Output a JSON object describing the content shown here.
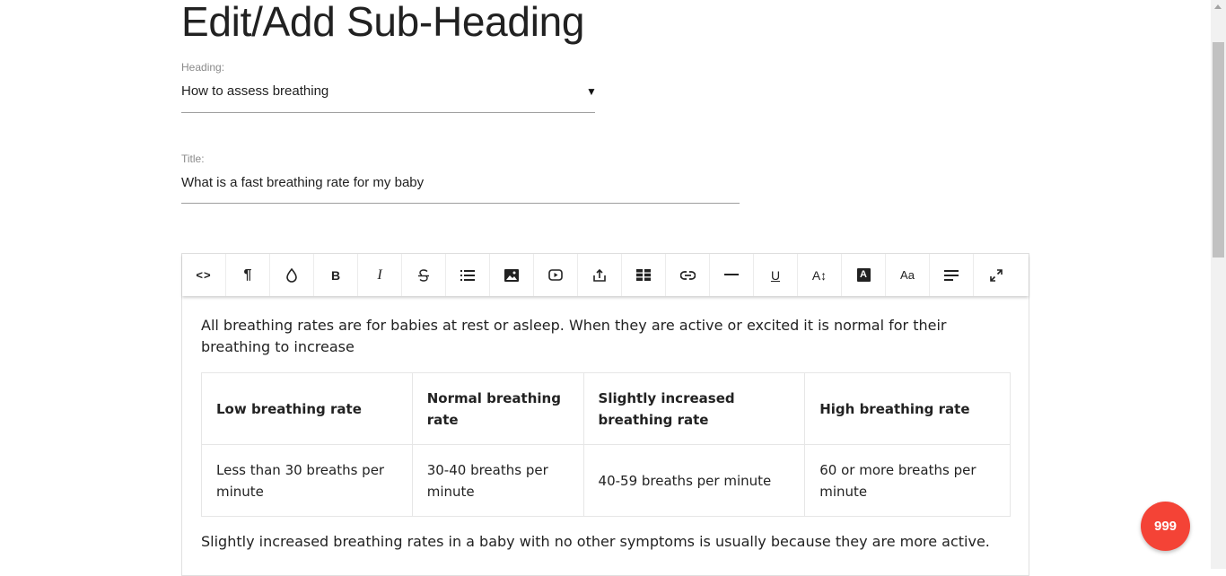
{
  "page": {
    "title": "Edit/Add Sub-Heading"
  },
  "heading_field": {
    "label": "Heading:",
    "value": "How to assess breathing",
    "caret": "▼"
  },
  "title_field": {
    "label": "Title:",
    "value": "What is a fast breathing rate for my baby"
  },
  "toolbar": {
    "buttons": [
      {
        "name": "code-view-button",
        "icon": "code-icon"
      },
      {
        "name": "paragraph-format-button",
        "icon": "paragraph-icon"
      },
      {
        "name": "color-button",
        "icon": "drop-icon"
      },
      {
        "name": "bold-button",
        "icon": "bold-icon"
      },
      {
        "name": "italic-button",
        "icon": "italic-icon"
      },
      {
        "name": "strikethrough-button",
        "icon": "strikethrough-icon"
      },
      {
        "name": "list-button",
        "icon": "list-icon"
      },
      {
        "name": "insert-image-button",
        "icon": "image-icon"
      },
      {
        "name": "insert-video-button",
        "icon": "video-icon"
      },
      {
        "name": "upload-button",
        "icon": "upload-icon"
      },
      {
        "name": "insert-table-button",
        "icon": "table-icon"
      },
      {
        "name": "insert-link-button",
        "icon": "link-icon"
      },
      {
        "name": "horizontal-line-button",
        "icon": "horizontal-line-icon"
      },
      {
        "name": "underline-button",
        "icon": "underline-icon"
      },
      {
        "name": "font-size-button",
        "icon": "font-size-icon"
      },
      {
        "name": "text-color-button",
        "icon": "text-color-icon"
      },
      {
        "name": "font-family-button",
        "icon": "font-family-icon"
      },
      {
        "name": "align-button",
        "icon": "align-left-icon"
      },
      {
        "name": "fullscreen-button",
        "icon": "fullscreen-icon"
      }
    ],
    "labels": {
      "code": "<>",
      "paragraph": "¶",
      "bold": "B",
      "italic": "I",
      "underline": "U",
      "font_size": "A↕",
      "text_color": "A",
      "font_family": "Aa"
    }
  },
  "content": {
    "intro": "All breathing rates are for babies at rest or asleep. When they are active or excited it is normal for their breathing to increase",
    "table": {
      "headers": [
        "Low breathing rate",
        "Normal breathing rate",
        "Slightly increased breathing rate",
        "High breathing rate"
      ],
      "row": [
        "Less than 30 breaths per minute",
        "30-40 breaths per minute",
        "40-59 breaths per minute",
        "60 or more breaths per minute"
      ]
    },
    "after": "Slightly increased breathing rates in a baby with no other symptoms is usually because they are more active."
  },
  "badge": {
    "count": "999",
    "color": "#f44336"
  }
}
